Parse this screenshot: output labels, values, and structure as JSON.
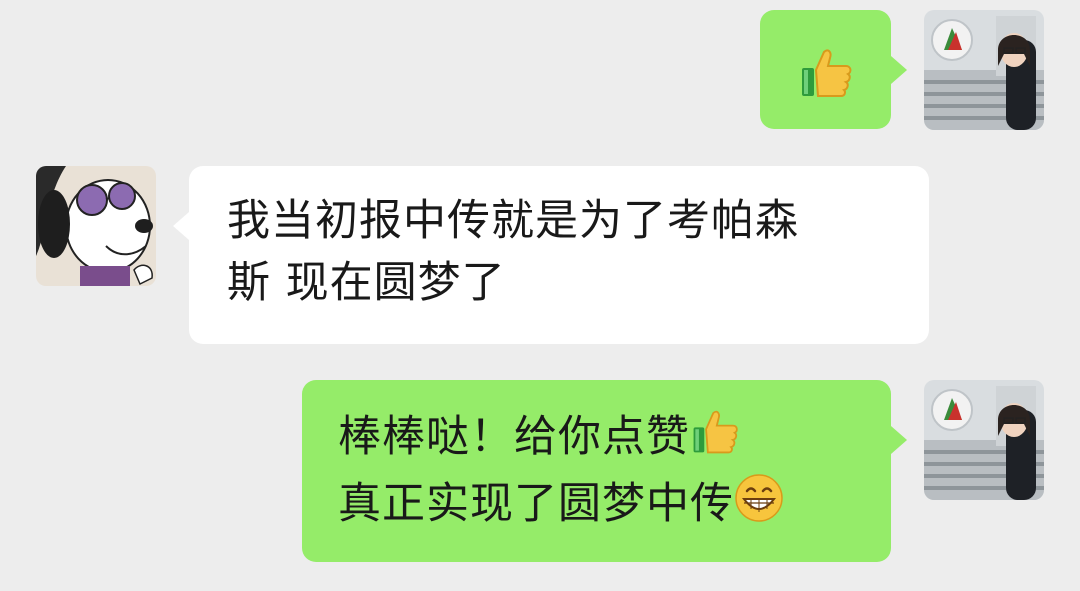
{
  "messages": [
    {
      "side": "right",
      "sender": "self",
      "emoji": "thumbs-up-icon"
    },
    {
      "side": "left",
      "sender": "friend",
      "lines": [
        "我当初报中传就是为了考帕森",
        "斯 现在圆梦了"
      ]
    },
    {
      "side": "right",
      "sender": "self",
      "line1": "棒棒哒！给你点赞",
      "line1_emoji": "thumbs-up-icon",
      "line2": "真正实现了圆梦中传",
      "line2_emoji": "grinning-face-icon"
    }
  ],
  "colors": {
    "background": "#ededed",
    "incoming_bubble": "#ffffff",
    "outgoing_bubble": "#95ec69",
    "text": "#191919"
  }
}
